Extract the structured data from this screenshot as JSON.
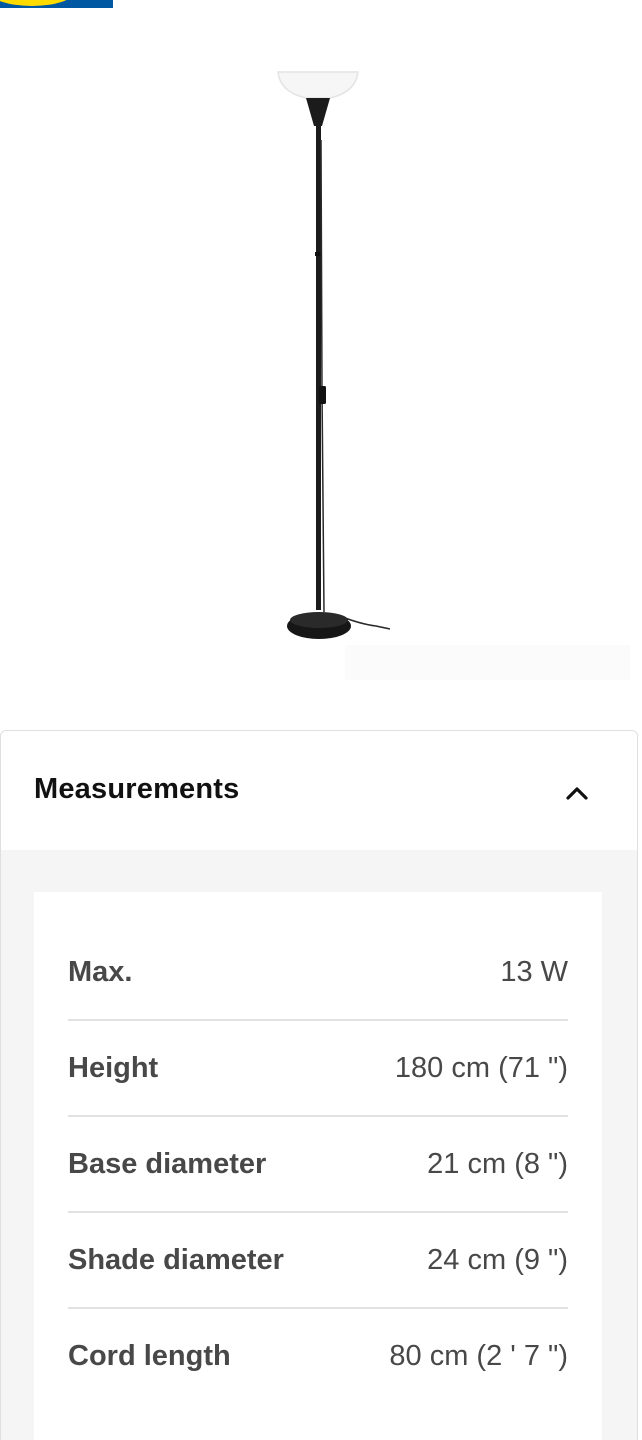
{
  "logo": {
    "icon": "ikea-logo-icon",
    "colors": {
      "blue": "#0058a3",
      "yellow": "#ffdb00"
    }
  },
  "product_image": {
    "alt": "floor-lamp-image"
  },
  "measurements": {
    "title": "Measurements",
    "expanded": true,
    "toggle_icon": "chevron-up-icon",
    "rows": [
      {
        "label": "Max.",
        "value": "13 W"
      },
      {
        "label": "Height",
        "value": "180 cm (71 \")"
      },
      {
        "label": "Base diameter",
        "value": "21 cm (8 \")"
      },
      {
        "label": "Shade diameter",
        "value": "24 cm (9 \")"
      },
      {
        "label": "Cord length",
        "value": "80 cm (2 ' 7 \")"
      }
    ]
  }
}
